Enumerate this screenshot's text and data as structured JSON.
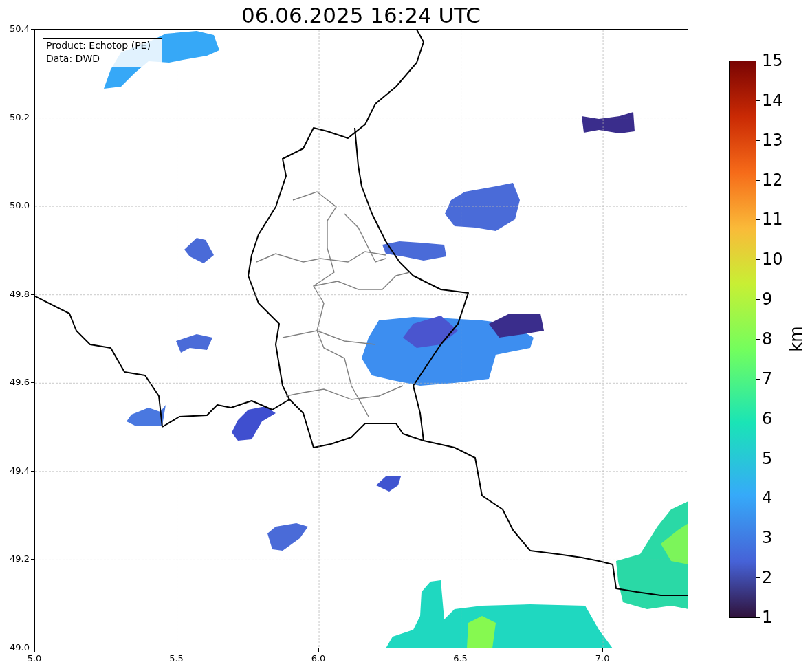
{
  "title": "06.06.2025 16:24 UTC",
  "map": {
    "info_lines": [
      "Product: Echotop (PE)",
      "Data: DWD"
    ],
    "x_ticks": [
      "5.0",
      "5.5",
      "6.0",
      "6.5",
      "7.0"
    ],
    "y_ticks": [
      "50.4",
      "50.2",
      "50.0",
      "49.8",
      "49.6",
      "49.4",
      "49.2",
      "49.0"
    ]
  },
  "colorbar": {
    "label": "km",
    "ticks": [
      "15",
      "14",
      "13",
      "12",
      "11",
      "10",
      "9",
      "8",
      "7",
      "6",
      "5",
      "4",
      "3",
      "2",
      "1"
    ]
  }
}
